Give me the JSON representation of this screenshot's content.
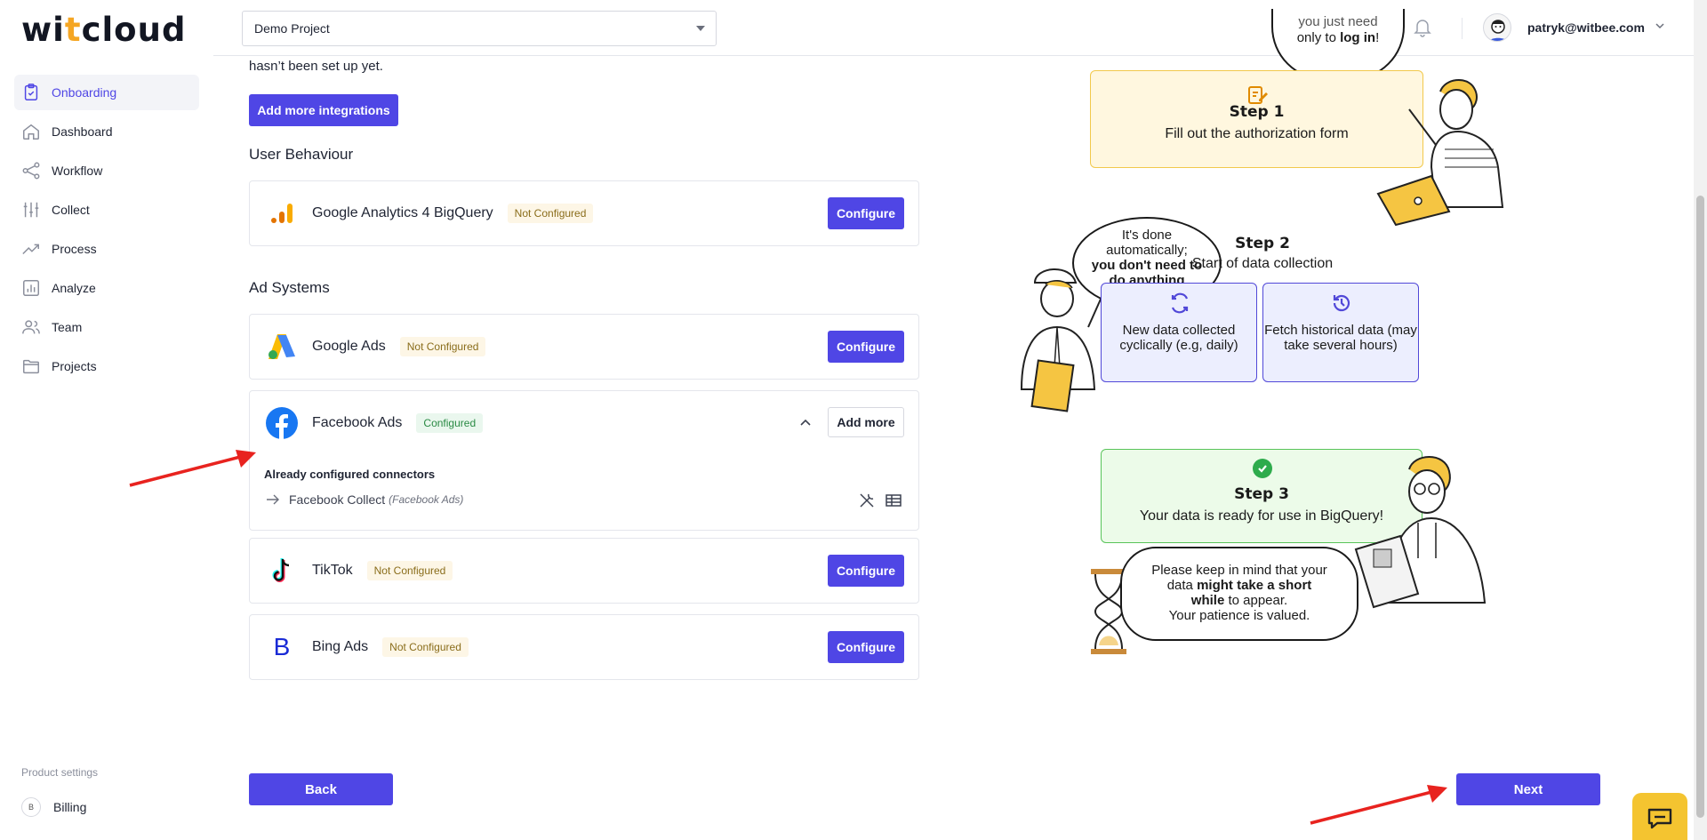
{
  "brand": {
    "logo_prefix": "wi",
    "logo_dot": "t",
    "logo_suffix": "cloud"
  },
  "sidebar": {
    "items": [
      {
        "label": "Onboarding",
        "icon": "clipboard-icon",
        "active": true
      },
      {
        "label": "Dashboard",
        "icon": "home-icon"
      },
      {
        "label": "Workflow",
        "icon": "share-icon"
      },
      {
        "label": "Collect",
        "icon": "sliders-icon"
      },
      {
        "label": "Process",
        "icon": "trend-icon"
      },
      {
        "label": "Analyze",
        "icon": "bar-chart-icon"
      },
      {
        "label": "Team",
        "icon": "users-icon"
      },
      {
        "label": "Projects",
        "icon": "folder-icon"
      }
    ],
    "settings_title": "Product settings",
    "billing": {
      "badge": "B",
      "label": "Billing"
    }
  },
  "header": {
    "project": "Demo Project",
    "user_email": "patryk@witbee.com"
  },
  "main": {
    "intro_text": "hasn’t been set up yet.",
    "add_integrations_label": "Add more integrations",
    "user_behaviour": {
      "title": "User Behaviour",
      "items": [
        {
          "name": "Google Analytics 4 BigQuery",
          "status": "Not Configured",
          "action": "Configure"
        }
      ]
    },
    "ad_systems": {
      "title": "Ad Systems",
      "items": [
        {
          "name": "Google Ads",
          "status": "Not Configured",
          "action": "Configure"
        },
        {
          "name": "Facebook Ads",
          "status": "Configured",
          "action": "Add more",
          "connectors_title": "Already configured connectors",
          "connector": {
            "name": "Facebook Collect",
            "source": "(Facebook Ads)"
          }
        },
        {
          "name": "TikTok",
          "status": "Not Configured",
          "action": "Configure"
        },
        {
          "name": "Bing Ads",
          "status": "Not Configured",
          "action": "Configure",
          "logo_letter": "B"
        }
      ]
    },
    "back_label": "Back",
    "next_label": "Next"
  },
  "illustration": {
    "bubble1": {
      "line1": "you just need",
      "line2": "only to ",
      "bold": "log in",
      "end": "!"
    },
    "step1": {
      "title": "Step 1",
      "desc": "Fill out the authorization form"
    },
    "bubble2": {
      "line1": "It's done",
      "line2": "automatically;",
      "bold1": "you don't need to",
      "bold2": "do anything"
    },
    "step2": {
      "title": "Step 2",
      "desc": "Start of data collection",
      "boxes": [
        {
          "text": "New data collected cyclically (e.g, daily)",
          "icon": "refresh-icon"
        },
        {
          "text": "Fetch historical data (may take several hours)",
          "icon": "history-icon"
        }
      ]
    },
    "step3": {
      "title": "Step 3",
      "desc": "Your data is ready for use in BigQuery!"
    },
    "bubble3": {
      "line1": "Please keep in mind that your",
      "line2a": "data ",
      "bold": "might take a short",
      "bold2": "while",
      "line3": " to appear.",
      "line4": "Your patience is valued."
    }
  },
  "colors": {
    "accent": "#4f46e5",
    "warning_bg": "#fdf6e6",
    "success": "#2eab4c",
    "annotation": "#e8231f"
  }
}
